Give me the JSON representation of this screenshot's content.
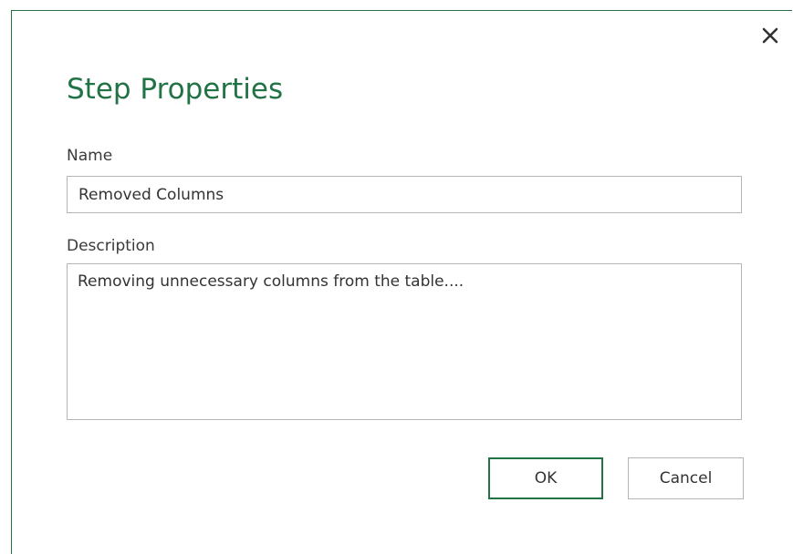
{
  "dialog": {
    "title": "Step Properties",
    "close_icon": "close-icon",
    "accent_color": "#217346"
  },
  "name_field": {
    "label": "Name",
    "value": "Removed Columns"
  },
  "description_field": {
    "label": "Description",
    "value": "Removing unnecessary columns from the table...."
  },
  "buttons": {
    "ok_label": "OK",
    "cancel_label": "Cancel"
  }
}
